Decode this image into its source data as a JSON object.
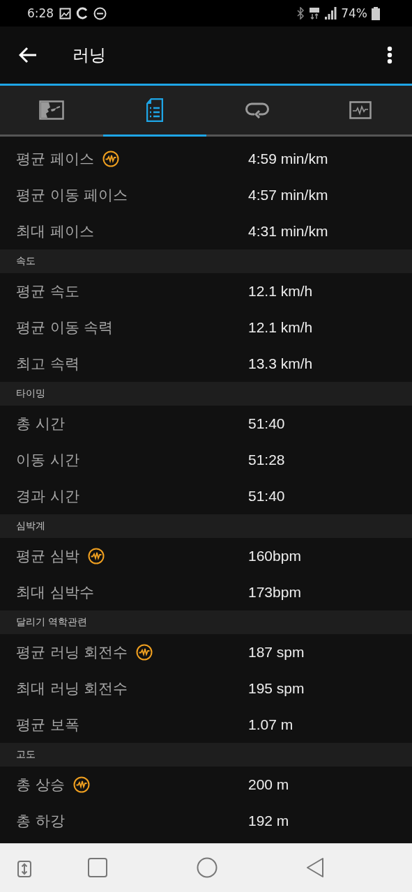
{
  "status_bar": {
    "time": "6:28",
    "battery": "74%"
  },
  "app_bar": {
    "title": "러닝"
  },
  "tabs": [
    {
      "kind": "map",
      "selected": false
    },
    {
      "kind": "list",
      "selected": true
    },
    {
      "kind": "laps",
      "selected": false
    },
    {
      "kind": "chart",
      "selected": false
    }
  ],
  "sections": [
    {
      "rows": [
        {
          "label": "평균 페이스",
          "value": "4:59 min/km",
          "badge": true
        },
        {
          "label": "평균 이동 페이스",
          "value": "4:57 min/km",
          "badge": false
        },
        {
          "label": "최대 페이스",
          "value": "4:31 min/km",
          "badge": false
        }
      ]
    },
    {
      "header": "속도",
      "rows": [
        {
          "label": "평균 속도",
          "value": "12.1 km/h",
          "badge": false
        },
        {
          "label": "평균 이동 속력",
          "value": "12.1 km/h",
          "badge": false
        },
        {
          "label": "최고 속력",
          "value": "13.3 km/h",
          "badge": false
        }
      ]
    },
    {
      "header": "타이밍",
      "rows": [
        {
          "label": "총 시간",
          "value": "51:40",
          "badge": false
        },
        {
          "label": "이동 시간",
          "value": "51:28",
          "badge": false
        },
        {
          "label": "경과 시간",
          "value": "51:40",
          "badge": false
        }
      ]
    },
    {
      "header": "심박계",
      "rows": [
        {
          "label": "평균 심박",
          "value": "160bpm",
          "badge": true
        },
        {
          "label": "최대 심박수",
          "value": "173bpm",
          "badge": false
        }
      ]
    },
    {
      "header": "달리기 역학관련",
      "rows": [
        {
          "label": "평균 러닝 회전수",
          "value": "187 spm",
          "badge": true
        },
        {
          "label": "최대 러닝 회전수",
          "value": "195 spm",
          "badge": false
        },
        {
          "label": "평균 보폭",
          "value": "1.07 m",
          "badge": false
        }
      ]
    },
    {
      "header": "고도",
      "rows": [
        {
          "label": "총 상승",
          "value": "200 m",
          "badge": true
        },
        {
          "label": "총 하강",
          "value": "192 m",
          "badge": false
        }
      ]
    }
  ]
}
